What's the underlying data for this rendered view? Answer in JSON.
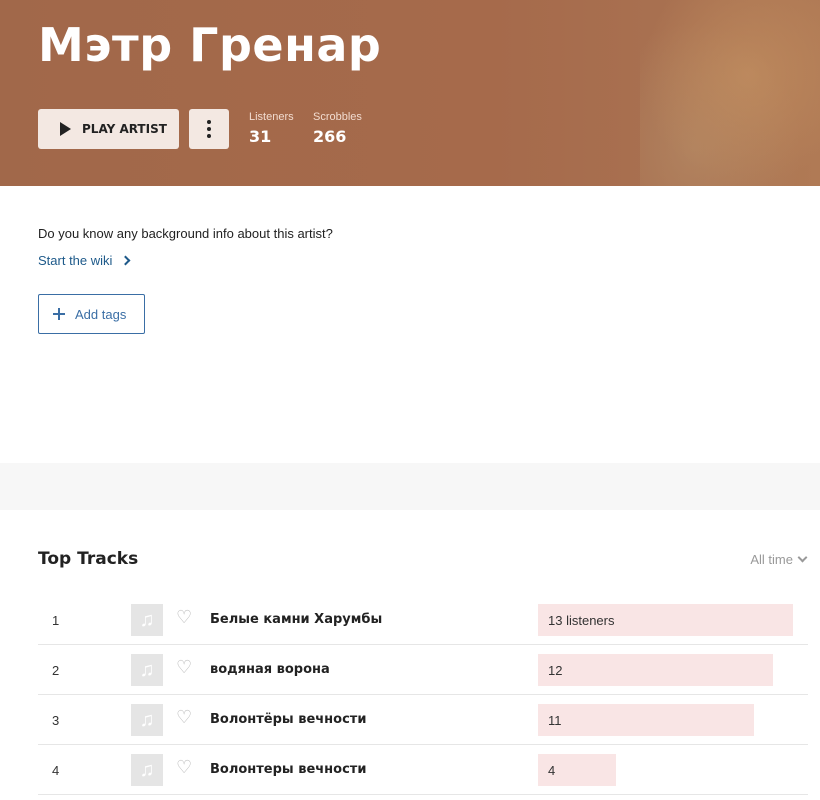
{
  "artist": {
    "name": "Мэтр Гренар",
    "play_label": "PLAY ARTIST",
    "more_icon": "more-vertical-icon",
    "listeners_label": "Listeners",
    "listeners_value": "31",
    "scrobbles_label": "Scrobbles",
    "scrobbles_value": "266"
  },
  "wiki": {
    "question": "Do you know any background info about this artist?",
    "link_label": "Start the wiki"
  },
  "tags": {
    "add_label": "Add tags"
  },
  "top_tracks": {
    "title": "Top Tracks",
    "period": "All time",
    "max_listeners": 13,
    "tracks": [
      {
        "rank": "1",
        "name": "Белые камни Харумбы",
        "listeners": 13,
        "listeners_label": "13 listeners"
      },
      {
        "rank": "2",
        "name": "водяная ворона",
        "listeners": 12,
        "listeners_label": "12"
      },
      {
        "rank": "3",
        "name": "Волонтёры вечности",
        "listeners": 11,
        "listeners_label": "11"
      },
      {
        "rank": "4",
        "name": "Волонтеры вечности",
        "listeners": 4,
        "listeners_label": "4"
      }
    ]
  },
  "colors": {
    "header_bg": "#a66a4b",
    "link": "#1e5a8a",
    "bar": "#f9e5e5"
  }
}
